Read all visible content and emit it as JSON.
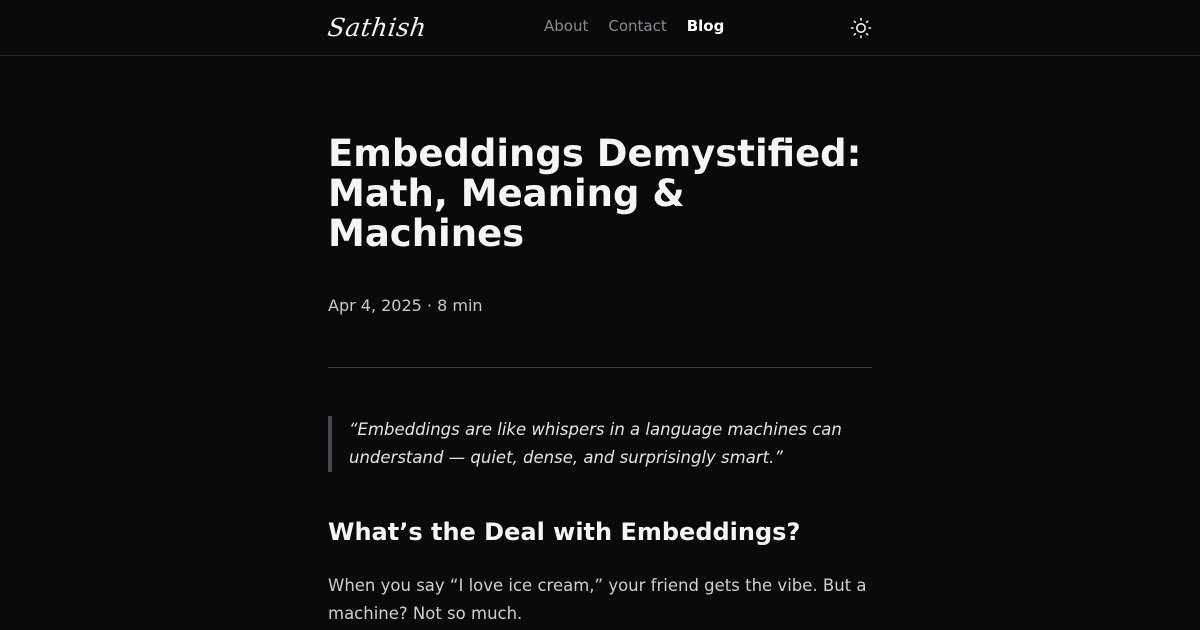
{
  "header": {
    "logo": "Sathish",
    "nav": [
      {
        "label": "About",
        "active": false
      },
      {
        "label": "Contact",
        "active": false
      },
      {
        "label": "Blog",
        "active": true
      }
    ],
    "theme_toggle_icon": "sun-icon"
  },
  "article": {
    "title": "Embeddings Demystified: Math, Meaning & Machines",
    "meta": "Apr 4, 2025 · 8 min",
    "quote": "“Embeddings are like whispers in a language machines can understand — quiet, dense, and surprisingly smart.”",
    "section_heading": "What’s the Deal with Embeddings?",
    "paragraph": "When you say “I love ice cream,” your friend gets the vibe. But a machine? Not so much."
  },
  "colors": {
    "background": "#0a0a0c",
    "text": "#ededed",
    "muted": "#8a8a90"
  }
}
